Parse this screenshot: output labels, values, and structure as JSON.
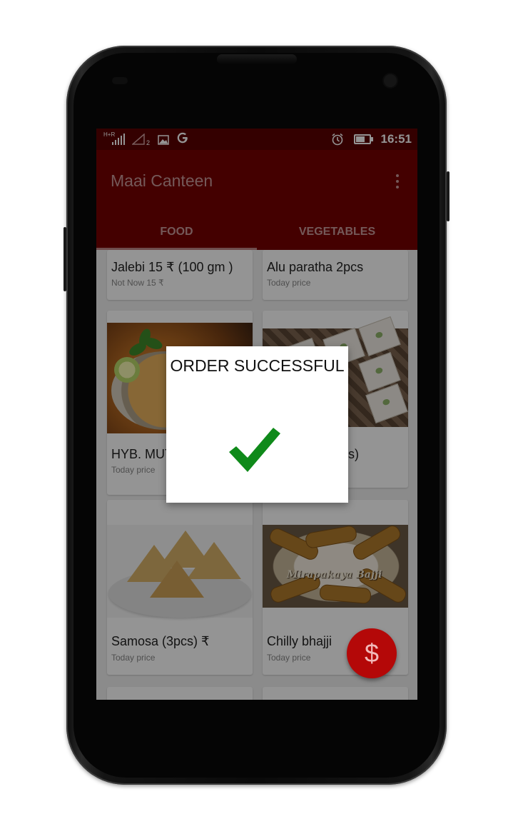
{
  "status_bar": {
    "network": "H+R",
    "sim_slot": "2",
    "time": "16:51",
    "icons": [
      "signal-icon",
      "signal-empty-icon",
      "image-notification-icon",
      "google-icon",
      "alarm-icon",
      "battery-charging-icon"
    ]
  },
  "app": {
    "title": "Maai Canteen",
    "tabs": [
      {
        "label": "FOOD",
        "selected": true
      },
      {
        "label": "VEGETABLES",
        "selected": false
      }
    ]
  },
  "menu": [
    {
      "name": "Jalebi 15 ₹ (100 gm )",
      "price": "Not Now 15 ₹"
    },
    {
      "name": "Alu paratha 2pcs",
      "price": "Today price"
    },
    {
      "name": "HYB. MUT",
      "price": "Today price"
    },
    {
      "name": "s)",
      "price": ""
    },
    {
      "name": "Samosa (3pcs)   ₹",
      "price": "Today price"
    },
    {
      "name": "Chilly bhajji",
      "price": "Today price",
      "image_caption": "Mirapakaya Bajji"
    }
  ],
  "dialog": {
    "title": "ORDER SUCCESSFUL",
    "icon": "checkmark-icon",
    "check_color": "#0f8a1a"
  },
  "fab": {
    "symbol": "$",
    "color": "#b40808"
  },
  "colors": {
    "primary": "#760000",
    "status_bar": "#5a0000",
    "overlay": "rgba(0,0,0,0.42)"
  }
}
